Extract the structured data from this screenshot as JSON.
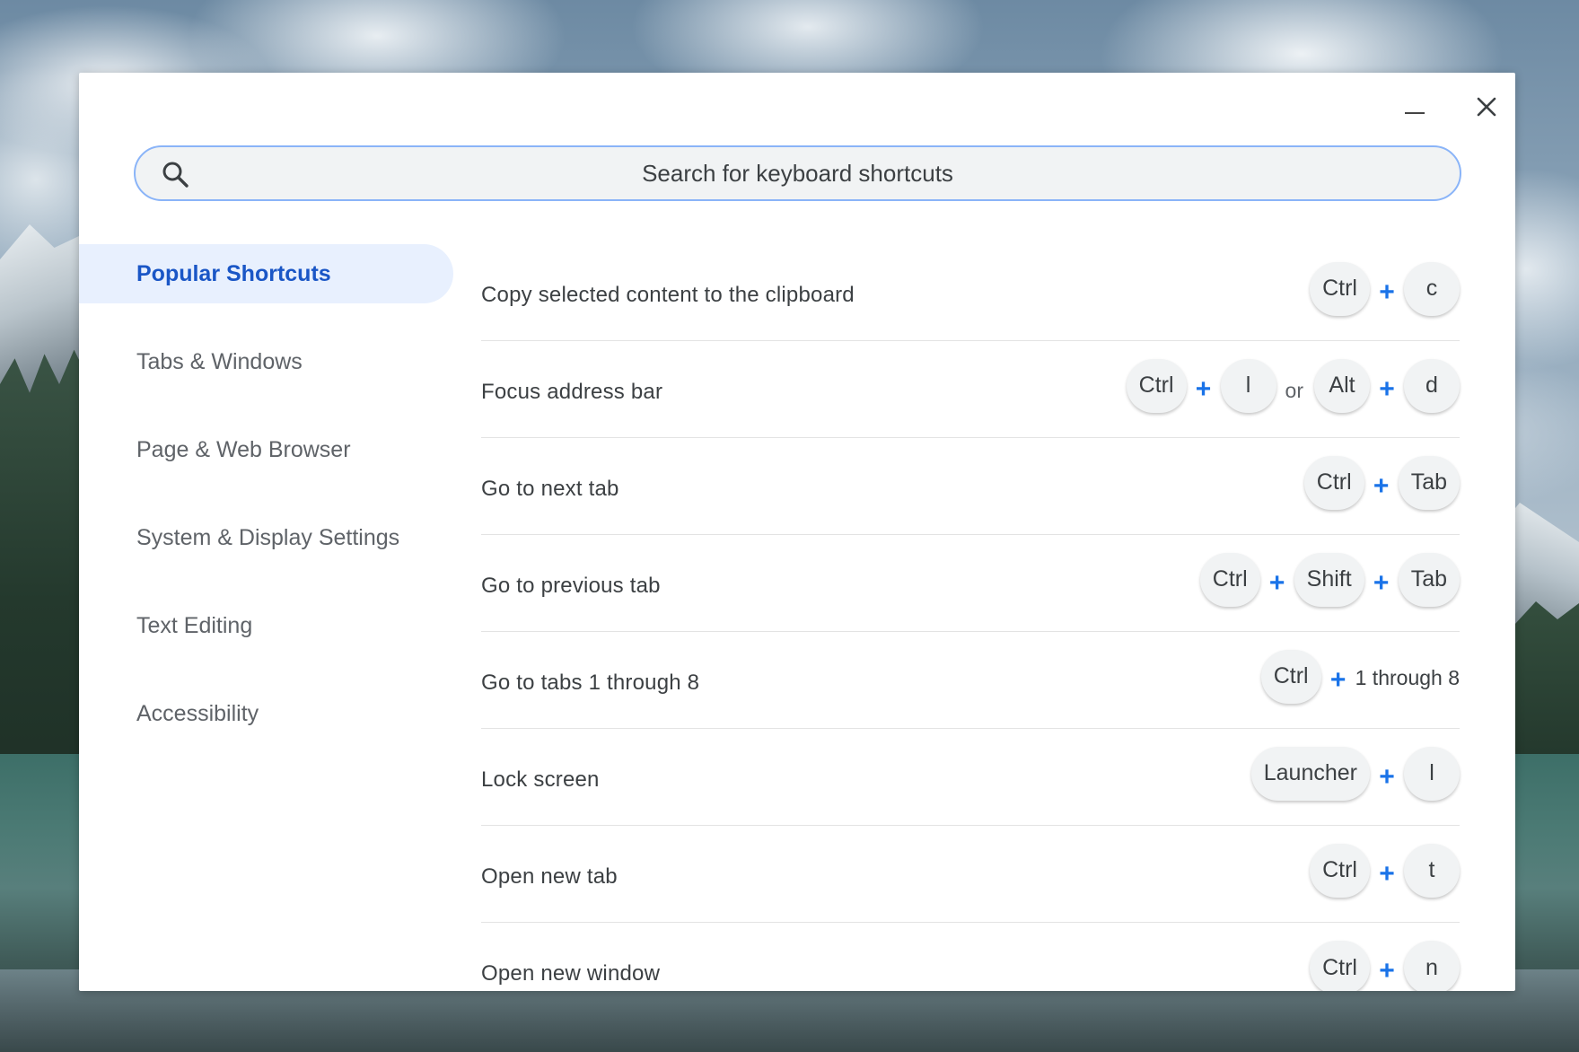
{
  "window": {
    "minimize_label": "Minimize",
    "close_label": "Close"
  },
  "search": {
    "placeholder": "Search for keyboard shortcuts"
  },
  "sidebar": {
    "items": [
      {
        "label": "Popular Shortcuts",
        "active": true
      },
      {
        "label": "Tabs & Windows",
        "active": false
      },
      {
        "label": "Page & Web Browser",
        "active": false
      },
      {
        "label": "System & Display Settings",
        "active": false
      },
      {
        "label": "Text Editing",
        "active": false
      },
      {
        "label": "Accessibility",
        "active": false
      }
    ]
  },
  "shortcuts": [
    {
      "description": "Copy selected content to the clipboard",
      "k1": "Ctrl",
      "k2": "c"
    },
    {
      "description": "Focus address bar",
      "k1": "Ctrl",
      "k2": "l",
      "or_text": "or",
      "k3": "Alt",
      "k4": "d"
    },
    {
      "description": "Go to next tab",
      "k1": "Ctrl",
      "k2": "Tab"
    },
    {
      "description": "Go to previous tab",
      "k1": "Ctrl",
      "k2": "Shift",
      "k3": "Tab"
    },
    {
      "description": "Go to tabs 1 through 8",
      "k1": "Ctrl",
      "range": "1 through 8"
    },
    {
      "description": "Lock screen",
      "k1": "Launcher",
      "k2": "l"
    },
    {
      "description": "Open new tab",
      "k1": "Ctrl",
      "k2": "t"
    },
    {
      "description": "Open new window",
      "k1": "Ctrl",
      "k2": "n"
    }
  ],
  "plus_symbol": "+",
  "colors": {
    "accent": "#1a73e8",
    "active_nav_bg": "#e8f0fe",
    "active_nav_text": "#1a56c6",
    "search_border": "#8ab4f8"
  }
}
